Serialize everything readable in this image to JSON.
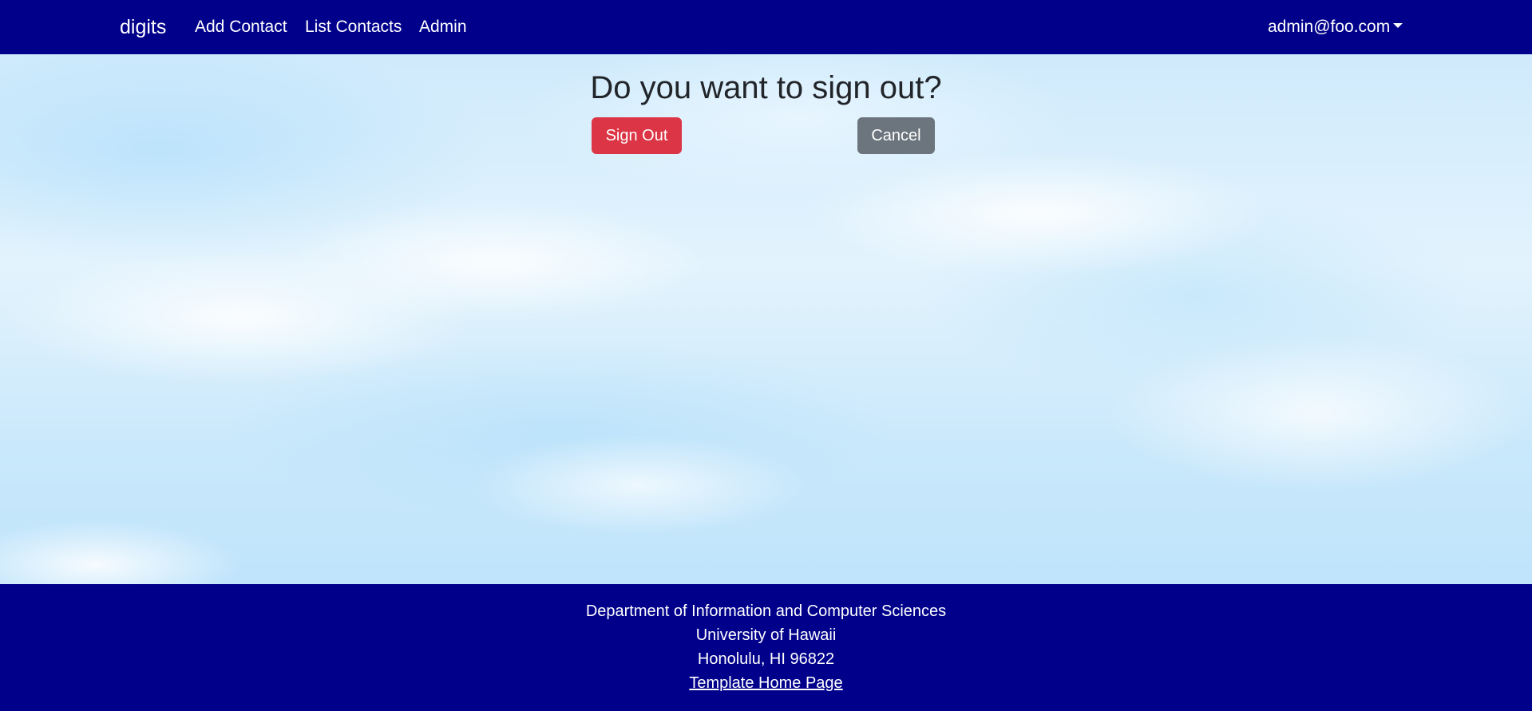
{
  "navbar": {
    "brand": "digits",
    "links": [
      "Add Contact",
      "List Contacts",
      "Admin"
    ],
    "user_menu": "admin@foo.com"
  },
  "main": {
    "title": "Do you want to sign out?",
    "sign_out_label": "Sign Out",
    "cancel_label": "Cancel"
  },
  "footer": {
    "department": "Department of Information and Computer Sciences",
    "university": "University of Hawaii",
    "address": "Honolulu, HI 96822",
    "link_label": "Template Home Page"
  },
  "colors": {
    "navbar_bg": "#00008b",
    "danger": "#dc3545",
    "secondary": "#6c757d"
  },
  "icons": {
    "user_menu_caret": "caret-down-icon"
  }
}
